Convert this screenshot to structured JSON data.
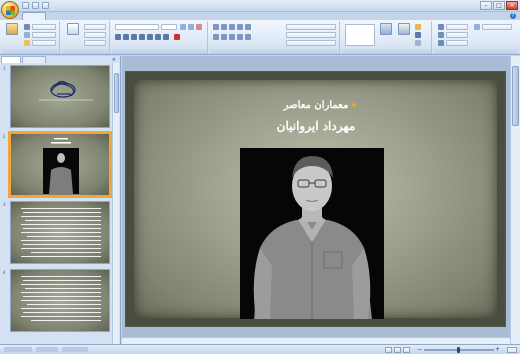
{
  "window": {
    "title": "",
    "controls": {
      "minimize": "–",
      "maximize": "□",
      "close": "×"
    }
  },
  "ribbon": {
    "help_icon": "?"
  },
  "left_panel": {
    "close": "×",
    "slides": [
      {
        "number": "1"
      },
      {
        "number": "2"
      },
      {
        "number": "3"
      },
      {
        "number": "4"
      }
    ]
  },
  "slide": {
    "title_line1": "معماران معاصر",
    "title_line2": "مهرداد ایروانیان",
    "bullet_color": "#e9a531",
    "photo_background": "#060606"
  },
  "colors": {
    "ribbon_top": "#f1f6fd",
    "selected_thumb_border": "#f4a53a",
    "slide_background": "#4a4e40"
  }
}
